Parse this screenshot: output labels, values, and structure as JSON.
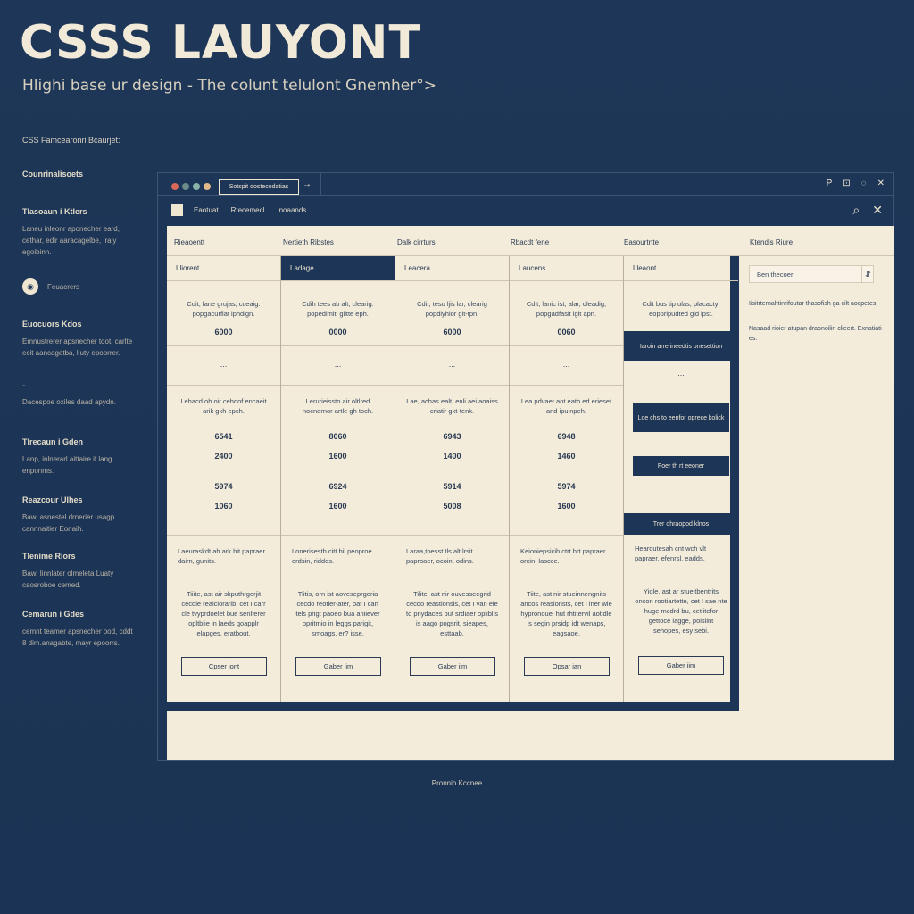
{
  "hero": {
    "title": "CSSS LAUYONT",
    "subtitle": "Hlighi base ur design - The colunt telulont Gnemher°>"
  },
  "sidebar": {
    "header": "CSS Famcearonri Bcaurjet:",
    "items": [
      {
        "title": "Counrinalisoets",
        "desc": ""
      },
      {
        "title": "Tlasoaun i Ktlers",
        "desc": "Laneu inleonr aponecher eard, cethar, edir aaracagelbe, Iraly egoibinn."
      },
      {
        "title": "Feuacrers",
        "desc": ""
      },
      {
        "title": "Euocuors Kdos",
        "desc": "Emnustrerer apsnecher toot, carlte ecit aancagetba, liuty epoorrer."
      },
      {
        "title": "",
        "desc": "Dacespoe oxiles daad apydn."
      },
      {
        "title": "Tlrecaun i Gden",
        "desc": "Lanp, inlnerarl aittaire if lang enponms."
      },
      {
        "title": "Reazcour Ulhes",
        "desc": "Baw, asnestel drnerier usagp cannnaitier Eonaih."
      },
      {
        "title": "Tlenime Riors",
        "desc": "Baw, Iinnlater olmeleta Luaty caosroboe cemed."
      },
      {
        "title": "Cemarun i Gdes",
        "desc": "cemnt teamer apsnecher ood, cddt 8 dim.anagabte, mayr epoorrs."
      }
    ]
  },
  "window": {
    "url": "Sotspit dostecodatias",
    "arrow": "→",
    "icons": [
      "P",
      "⊡",
      "◌",
      "✕"
    ],
    "toolbar_links": [
      "Eaotuat",
      "Rtecemecl",
      "Inoaands"
    ],
    "toolbar_right": [
      "⌕",
      "✕"
    ]
  },
  "columns": {
    "heads": [
      "Rieaoentt",
      "Nertieth Ribstes",
      "Dalk cirrturs",
      "Rbacdt fene",
      "Easourtrtte",
      "Ktendis Riure"
    ],
    "cards": [
      {
        "label": "Lliorent",
        "dark": false,
        "desc1": "Cdit, lane grujas, cceaig: popgacurfiat iphdign.",
        "num1": "6000",
        "desc2": "Lehacd ob oir cehdof encaeit arik gkh epch.",
        "num2": "6541",
        "num3": "2400",
        "num4": "5974",
        "num5": "1060",
        "desc3": "Laeuraskdt ah ark bit papraer dairn, gunits.",
        "desc4": "Tiiite, ast air skputhrgerjit cecdie realclorarib, cet I carr cle tvyprdoelet bue senlferer opltblie in laeds goapplr elapges, eratbout.",
        "btn": "Cpser iont"
      },
      {
        "label": "Ladage",
        "dark": true,
        "desc1": "Cdih tees ab alt, clearig: popedimitl glitte eph.",
        "num1": "0000",
        "desc2": "Lerurieissto air oltlred nocnernor artle gh toch.",
        "num2": "8060",
        "num3": "1600",
        "num4": "6924",
        "num5": "1600",
        "desc3": "Lonerisestb citt bil peoproe erdsin, riddes.",
        "desc4": "Tlitis, orn ist aoveseprgeria cecdo reotier-ater, oat I carr tels prigt paoeo bua ariiiever opritmio in leggs parigit, smoags, er? isse.",
        "btn": "Gaber iim"
      },
      {
        "label": "Leacera",
        "dark": false,
        "desc1": "Cdit, tesu ljis lar, clearig popdiyhior glt-tpn.",
        "num1": "6000",
        "desc2": "Lae, achas ealt, enli aei aoaiss criatir gkt-tenk.",
        "num2": "6943",
        "num3": "1400",
        "num4": "5914",
        "num5": "5008",
        "desc3": "Laraa,toesst tls alt lrsit paproaer, ocoin, odins.",
        "desc4": "Tilite, ast nir ouvesseegrid cecdo reastionsis, cet I van ele to pnydaces but srdiaer opliblis is aago pogsrit, sieapes, esttaab.",
        "btn": "Gaber iim"
      },
      {
        "label": "Laucens",
        "dark": false,
        "desc1": "Cdit, lanic ist, alar, dleadig; popgadfaslt igit apn.",
        "num1": "0060",
        "desc2": "Lea pdvaet aot eath ed erieset and ipulnpeh.",
        "num2": "6948",
        "num3": "1460",
        "num4": "5974",
        "num5": "1600",
        "desc3": "Keioniepsicih ctrt brt papraer orcin, lascce.",
        "desc4": "Tiite, ast nir stueinnengnits ancos reasionsts, cet I iner wie hypronouei hut rhtitervil aotidle is segin prsidp idt wenaps, eagsaoe.",
        "btn": "Opsar ian"
      },
      {
        "label": "Lleaont",
        "dark": false,
        "desc1": "Cdit bus tip ulas, placacty; eoppripudted gid ipst.",
        "num1": "",
        "desc2": "",
        "num2": "",
        "num3": "",
        "num4": "",
        "num5": "",
        "desc3": "Hearoutesah cnt wch vlt papraer, efenrsl, eadds.",
        "desc4": "Yiole, ast ar stueitbentrits oncon rootiartette, cet I sae nte huge mcdrd bu, cetlitefor gettoce lagge, polsiint sehopes, esy sebi.",
        "btn": "Gaber iim"
      }
    ],
    "dark_boxes": [
      "Iaroin arre ineedtis onesettion",
      "Loe chs to eenfor oprece kolick",
      "Foer th rt eeoner",
      "Trer ohraopod klnos"
    ]
  },
  "right_panel": {
    "input_value": "Ben thecoer",
    "arrow": "⇵",
    "desc1": "Iisitrternahtinrifoutar thasofish ga cilt aocpetes",
    "desc2": "Nasaad rioier atupan draonoilin clieert. Exnatiati es."
  },
  "footer": "Pronnio Kccnee"
}
